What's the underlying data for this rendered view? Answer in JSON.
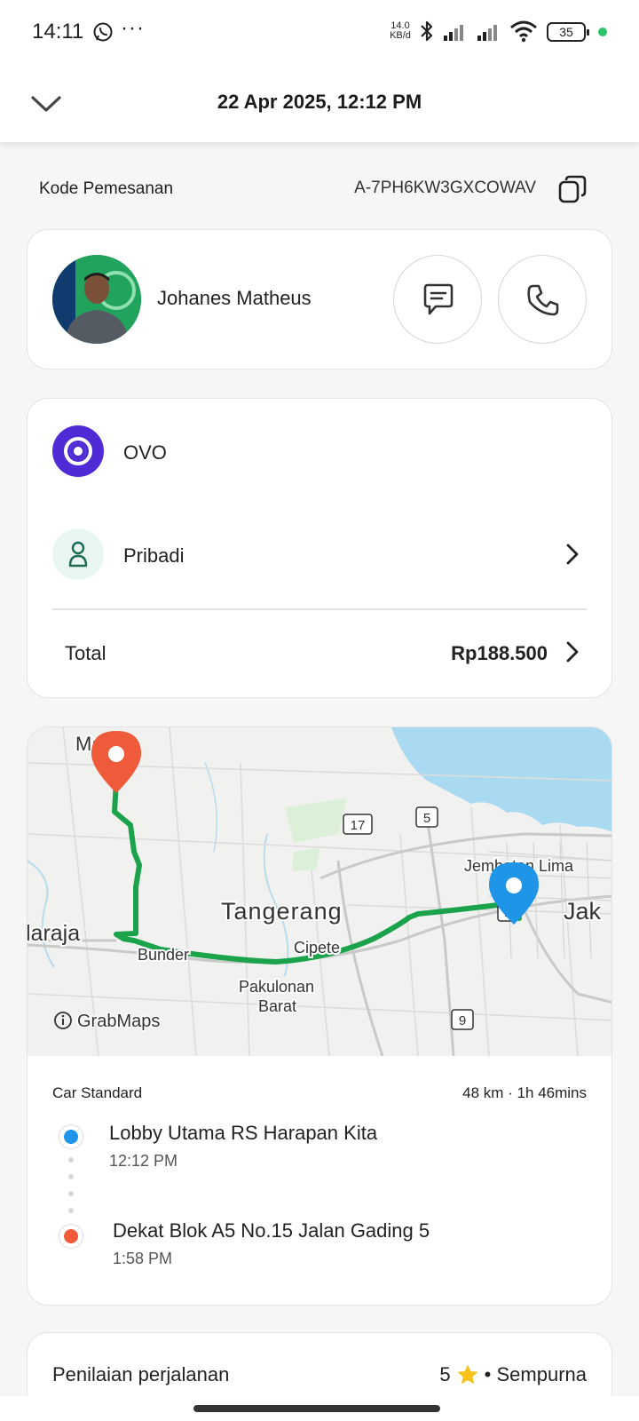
{
  "status_bar": {
    "time": "14:11",
    "dots": "···",
    "speed_top": "14.0",
    "speed_bottom": "KB/d",
    "battery": "35",
    "icons": [
      "whatsapp-icon",
      "bluetooth-icon",
      "signal-icon",
      "signal-icon",
      "wifi-icon",
      "battery-icon"
    ]
  },
  "header": {
    "title": "22 Apr 2025, 12:12 PM"
  },
  "booking": {
    "label": "Kode Pemesanan",
    "code": "A-7PH6KW3GXCOWAV"
  },
  "driver": {
    "name": "Johanes Matheus"
  },
  "payment": {
    "method": "OVO",
    "profile": "Pribadi",
    "total_label": "Total",
    "total_value": "Rp188.500",
    "colors": {
      "ovo": "#4f2bd6"
    }
  },
  "map": {
    "labels": {
      "mauk": "Mauk",
      "tangerang": "Tangerang",
      "balaraja": "laraja",
      "bunder": "Bunder",
      "cipete": "Cipete",
      "pakulonan1": "Pakulonan",
      "pakulonan2": "Barat",
      "jembatan": "Jembatan Lima",
      "jakarta": "Jak",
      "road17": "17",
      "road5": "5",
      "road9": "9",
      "road1": "1"
    },
    "brand": "GrabMaps",
    "colors": {
      "route": "#1aa34a",
      "water": "#aadaf2",
      "pickup_pin": "#1f95e8",
      "drop_pin": "#ee5a3a"
    }
  },
  "trip": {
    "vehicle": "Car Standard",
    "meta": "48 km · 1h 46mins",
    "pickup_name": "Lobby Utama RS Harapan Kita",
    "pickup_time": "12:12 PM",
    "drop_name": "Dekat Blok A5 No.15 Jalan Gading 5",
    "drop_time": "1:58 PM"
  },
  "rating": {
    "label": "Penilaian perjalanan",
    "stars": "5",
    "text": "• Sempurna"
  }
}
